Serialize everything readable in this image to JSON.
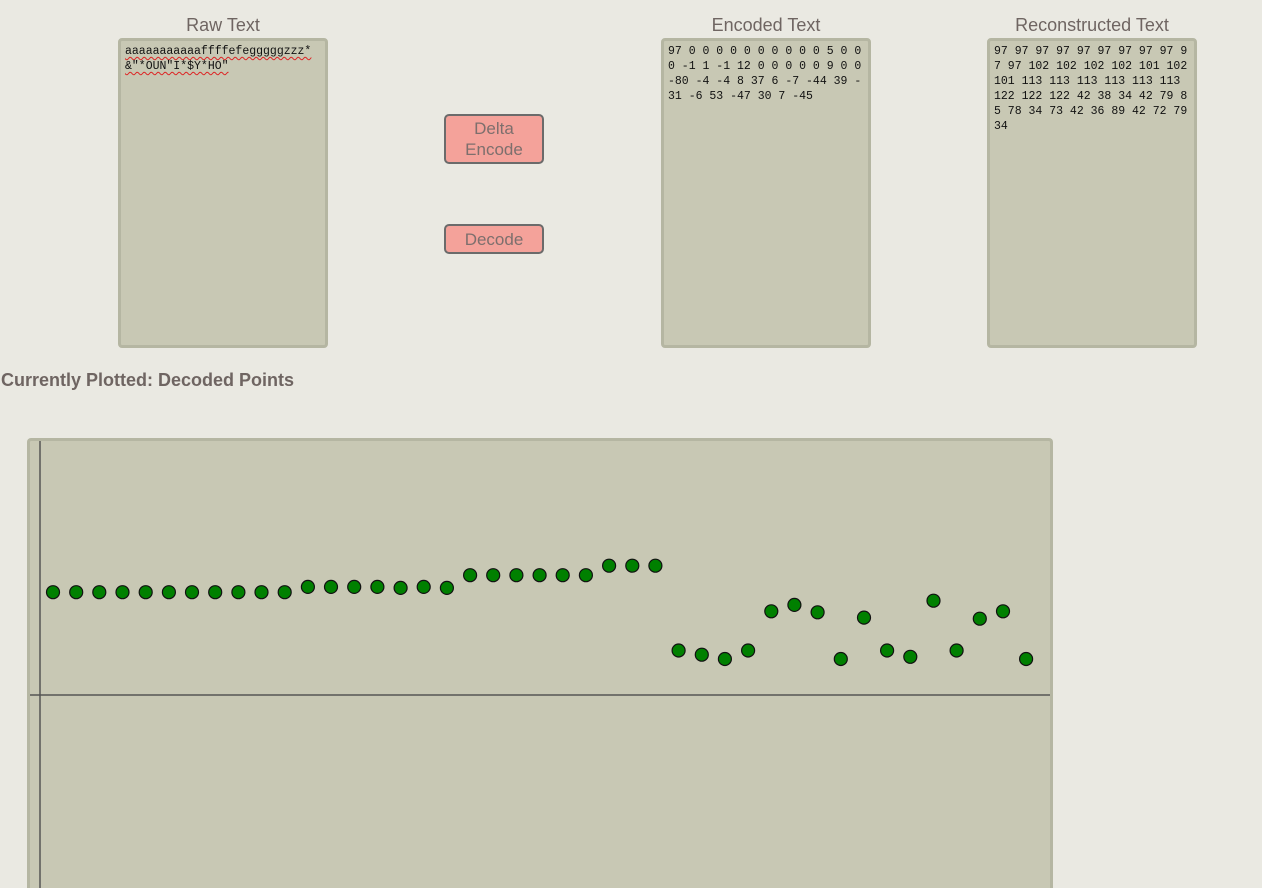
{
  "panels": {
    "raw": {
      "title": "Raw Text",
      "value": "aaaaaaaaaaaffffefegggggzzz*&\"*OUN\"I*$Y*HO\""
    },
    "encoded": {
      "title": "Encoded Text",
      "value": "97 0 0 0 0 0 0 0 0 0 0 5 0 0 0 -1 1 -1 12 0 0 0 0 0 9 0 0 -80 -4 -4 8 37 6 -7 -44 39 -31 -6 53 -47 30 7 -45"
    },
    "reconstructed": {
      "title": "Reconstructed Text",
      "value": "97 97 97 97 97 97 97 97 97 97 97 102 102 102 102 101 102 101 113 113 113 113 113 113 122 122 122 42 38 34 42 79 85 78 34 73 42 36 89 42 72 79 34"
    }
  },
  "buttons": {
    "encode_label": "Delta Encode",
    "decode_label": "Decode"
  },
  "plot": {
    "status": "Currently Plotted: Decoded Points"
  },
  "colors": {
    "background": "#eae9e2",
    "panel": "#c8c8b4",
    "panel_border": "#b5b6a2",
    "button": "#f4a29a",
    "point_fill": "#008000",
    "axis": "#555555"
  },
  "chart_data": {
    "type": "scatter",
    "title": "",
    "xlabel": "",
    "ylabel": "",
    "grid": false,
    "x": [
      0,
      1,
      2,
      3,
      4,
      5,
      6,
      7,
      8,
      9,
      10,
      11,
      12,
      13,
      14,
      15,
      16,
      17,
      18,
      19,
      20,
      21,
      22,
      23,
      24,
      25,
      26,
      27,
      28,
      29,
      30,
      31,
      32,
      33,
      34,
      35,
      36,
      37,
      38,
      39,
      40,
      41,
      42
    ],
    "y": [
      97,
      97,
      97,
      97,
      97,
      97,
      97,
      97,
      97,
      97,
      97,
      102,
      102,
      102,
      102,
      101,
      102,
      101,
      113,
      113,
      113,
      113,
      113,
      113,
      122,
      122,
      122,
      42,
      38,
      34,
      42,
      79,
      85,
      78,
      34,
      73,
      42,
      36,
      89,
      42,
      72,
      79,
      34
    ]
  }
}
